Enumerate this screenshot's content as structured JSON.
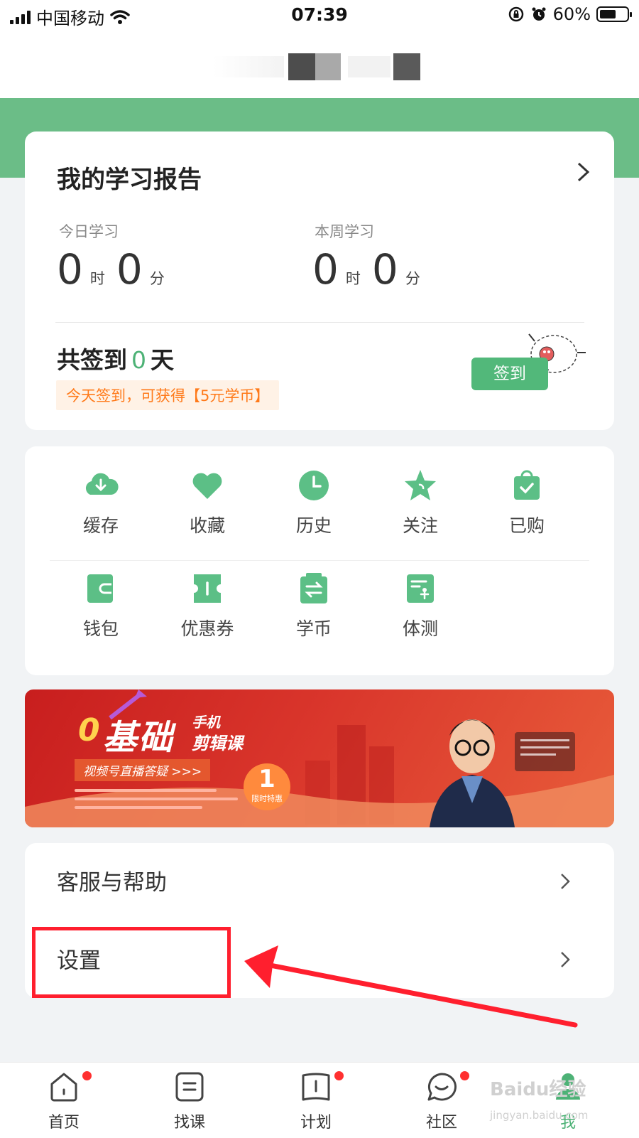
{
  "status_bar": {
    "carrier": "中国移动",
    "time": "07:39",
    "battery": "60%",
    "battery_level": 0.6
  },
  "colors": {
    "accent": "#4db276",
    "header_green": "#6bbd87",
    "alert": "#ff1f2e",
    "reward": "#ff7a1a"
  },
  "report": {
    "title": "我的学习报告",
    "today": {
      "label": "今日学习",
      "hours": "0",
      "hour_unit": "时",
      "minutes": "0",
      "minute_unit": "分"
    },
    "week": {
      "label": "本周学习",
      "hours": "0",
      "hour_unit": "时",
      "minutes": "0",
      "minute_unit": "分"
    },
    "signin_prefix": "共签到",
    "signin_days": "0",
    "signin_suffix": "天",
    "reward": "今天签到，可获得【5元学币】",
    "signin_button": "签到"
  },
  "menu": {
    "row1": [
      {
        "label": "缓存",
        "icon": "download-cloud-icon"
      },
      {
        "label": "收藏",
        "icon": "heart-icon"
      },
      {
        "label": "历史",
        "icon": "clock-icon"
      },
      {
        "label": "关注",
        "icon": "star-icon"
      },
      {
        "label": "已购",
        "icon": "shopping-bag-icon"
      }
    ],
    "row2": [
      {
        "label": "钱包",
        "icon": "wallet-icon"
      },
      {
        "label": "优惠券",
        "icon": "coupon-icon"
      },
      {
        "label": "学币",
        "icon": "coin-exchange-icon"
      },
      {
        "label": "体测",
        "icon": "test-report-icon"
      }
    ]
  },
  "banner": {
    "num": "0",
    "title": "基础",
    "title_tag1": "手机",
    "title_tag2": "剪辑课",
    "subtitle": "视频号直播答疑 >>>",
    "price": "1",
    "price_tag": "限时特惠"
  },
  "list": {
    "help": "客服与帮助",
    "settings": "设置"
  },
  "tabs": [
    {
      "label": "首页",
      "icon": "home-icon"
    },
    {
      "label": "找课",
      "icon": "search-course-icon"
    },
    {
      "label": "计划",
      "icon": "plan-icon"
    },
    {
      "label": "社区",
      "icon": "community-icon"
    },
    {
      "label": "我",
      "icon": "profile-icon"
    }
  ],
  "watermark": "Baidu经验",
  "watermark_url": "jingyan.baidu.com"
}
